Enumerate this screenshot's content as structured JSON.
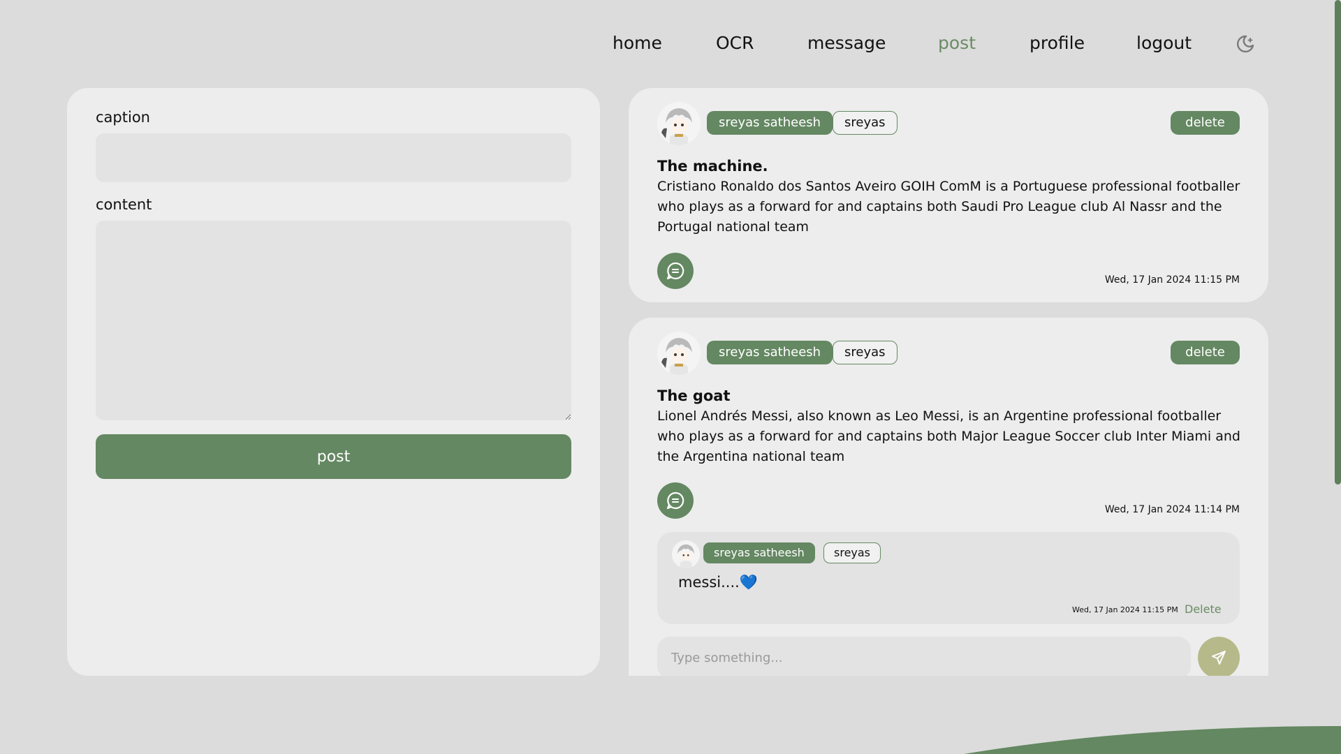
{
  "nav": {
    "home": "home",
    "ocr": "OCR",
    "message": "message",
    "post": "post",
    "profile": "profile",
    "logout": "logout"
  },
  "composer": {
    "caption_label": "caption",
    "caption_value": "",
    "content_label": "content",
    "content_value": "",
    "post_button": "post"
  },
  "posts": [
    {
      "author_name": "sreyas satheesh",
      "author_username": "sreyas",
      "delete_label": "delete",
      "title": "The machine.",
      "body": "Cristiano Ronaldo dos Santos Aveiro GOIH ComM is a Portuguese professional footballer who plays as a forward for and captains both Saudi Pro League club Al Nassr and the Portugal national team",
      "timestamp": "Wed, 17 Jan 2024 11:15 PM"
    },
    {
      "author_name": "sreyas satheesh",
      "author_username": "sreyas",
      "delete_label": "delete",
      "title": "The goat",
      "body": "Lionel Andrés Messi, also known as Leo Messi, is an Argentine professional footballer who plays as a forward for and captains both Major League Soccer club Inter Miami and the Argentina national team",
      "timestamp": "Wed, 17 Jan 2024 11:14 PM",
      "comments": [
        {
          "author_name": "sreyas satheesh",
          "author_username": "sreyas",
          "text": "messi....",
          "emoji": "💙",
          "timestamp": "Wed, 17 Jan 2024 11:15 PM",
          "delete_label": "Delete"
        }
      ],
      "comment_placeholder": "Type something..."
    }
  ],
  "colors": {
    "background": "#dcdcdc",
    "card": "#ededed",
    "accent": "#648862",
    "send_button": "#b6b98a"
  }
}
